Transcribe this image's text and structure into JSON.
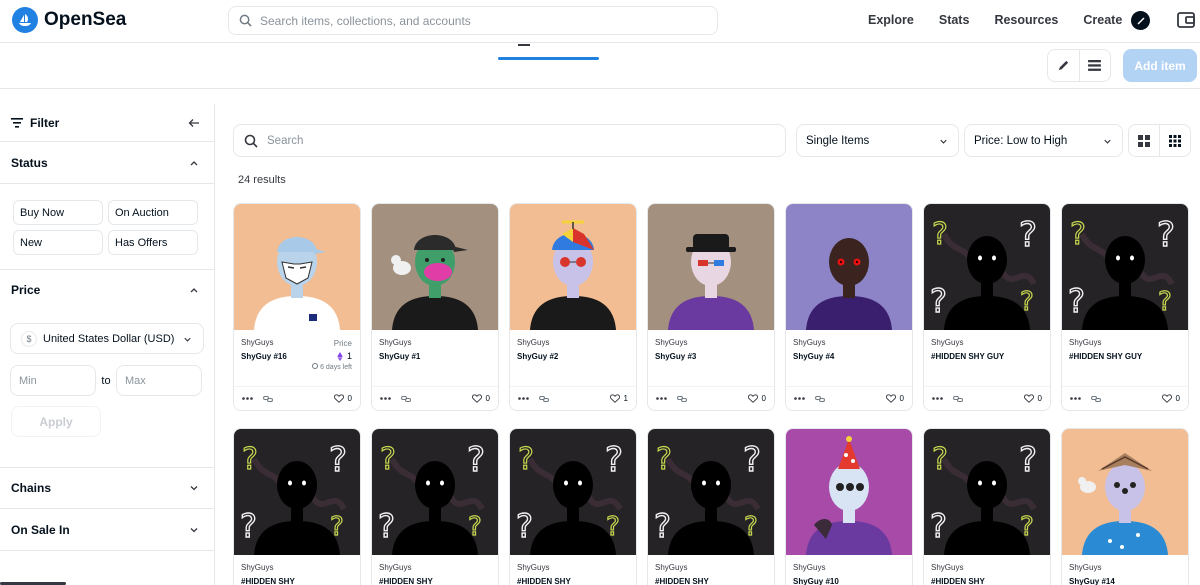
{
  "app": {
    "name": "OpenSea",
    "brand_color": "#2081e2"
  },
  "nav": {
    "search_placeholder": "Search items, collections, and accounts",
    "links": [
      "Explore",
      "Stats",
      "Resources",
      "Create"
    ]
  },
  "toolbar": {
    "add_item": "Add item"
  },
  "sidebar": {
    "filter": "Filter",
    "status": {
      "title": "Status",
      "options": [
        "Buy Now",
        "On Auction",
        "New",
        "Has Offers"
      ]
    },
    "price": {
      "title": "Price",
      "currency": "United States Dollar (USD)",
      "min_placeholder": "Min",
      "max_placeholder": "Max",
      "to": "to",
      "apply": "Apply"
    },
    "chains": "Chains",
    "on_sale_in": "On Sale In"
  },
  "main": {
    "search_placeholder": "Search",
    "item_type": "Single Items",
    "sort": "Price: Low to High",
    "results": "24 results"
  },
  "cards": [
    {
      "collection": "ShyGuys",
      "name": "ShyGuy #16",
      "price_label": "Price",
      "price": "1",
      "time_left": "6 days left",
      "likes": "0",
      "art": "shy16"
    },
    {
      "collection": "ShyGuys",
      "name": "ShyGuy #1",
      "likes": "0",
      "art": "shy1"
    },
    {
      "collection": "ShyGuys",
      "name": "ShyGuy #2",
      "likes": "1",
      "art": "shy2"
    },
    {
      "collection": "ShyGuys",
      "name": "ShyGuy #3",
      "likes": "0",
      "art": "shy3"
    },
    {
      "collection": "ShyGuys",
      "name": "ShyGuy #4",
      "likes": "0",
      "art": "shy4"
    },
    {
      "collection": "ShyGuys",
      "name": "#HIDDEN SHY GUY",
      "likes": "0",
      "art": "hidden"
    },
    {
      "collection": "ShyGuys",
      "name": "#HIDDEN SHY GUY",
      "likes": "0",
      "art": "hidden"
    },
    {
      "collection": "ShyGuys",
      "name": "#HIDDEN SHY",
      "art": "hidden"
    },
    {
      "collection": "ShyGuys",
      "name": "#HIDDEN SHY",
      "art": "hidden"
    },
    {
      "collection": "ShyGuys",
      "name": "#HIDDEN SHY",
      "art": "hidden"
    },
    {
      "collection": "ShyGuys",
      "name": "#HIDDEN SHY",
      "art": "hidden"
    },
    {
      "collection": "ShyGuys",
      "name": "ShyGuy #10",
      "art": "shy10"
    },
    {
      "collection": "ShyGuys",
      "name": "#HIDDEN SHY",
      "art": "hidden"
    },
    {
      "collection": "ShyGuys",
      "name": "ShyGuy #14",
      "art": "shy14"
    }
  ]
}
